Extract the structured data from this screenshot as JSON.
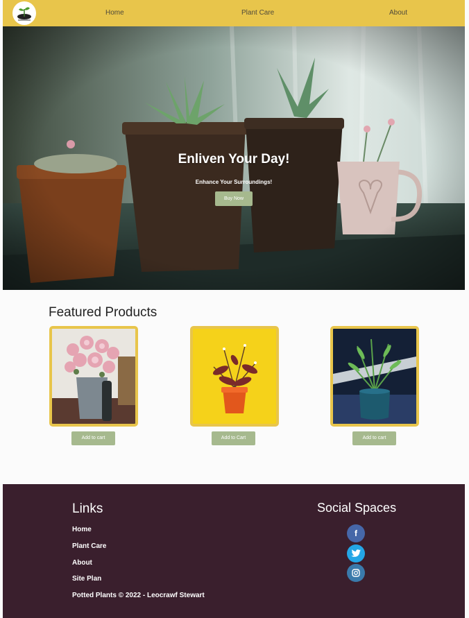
{
  "nav": {
    "logo_text": "Potted Plants",
    "home": "Home",
    "plant_care": "Plant Care",
    "about": "About"
  },
  "hero": {
    "title": "Enliven Your Day!",
    "subtitle": "Enhance Your Surroundings!",
    "button": "Buy Now"
  },
  "featured": {
    "title": "Featured Products",
    "products": [
      {
        "image": "pink-flowers-in-metal-bucket",
        "button": "Add to cart"
      },
      {
        "image": "orange-pot-plant-on-yellow",
        "button": "Add to Cart"
      },
      {
        "image": "palm-in-blue-pot",
        "button": "Add to cart"
      }
    ]
  },
  "footer": {
    "links_title": "Links",
    "links": [
      "Home",
      "Plant Care",
      "About",
      "Site Plan"
    ],
    "copyright": "Potted Plants © 2022 - Leocrawf Stewart",
    "social_title": "Social Spaces",
    "social": [
      {
        "icon": "facebook-icon",
        "glyph": "f",
        "color": "#4667a8"
      },
      {
        "icon": "twitter-icon",
        "glyph": "t",
        "color": "#24a6e6"
      },
      {
        "icon": "instagram-icon",
        "glyph": "",
        "color": "#3a7aab"
      }
    ]
  },
  "colors": {
    "nav_bg": "#e8c54b",
    "accent_button": "#a6b98e",
    "footer_bg": "#3a1f2d",
    "card_border": "#e8c54b"
  }
}
